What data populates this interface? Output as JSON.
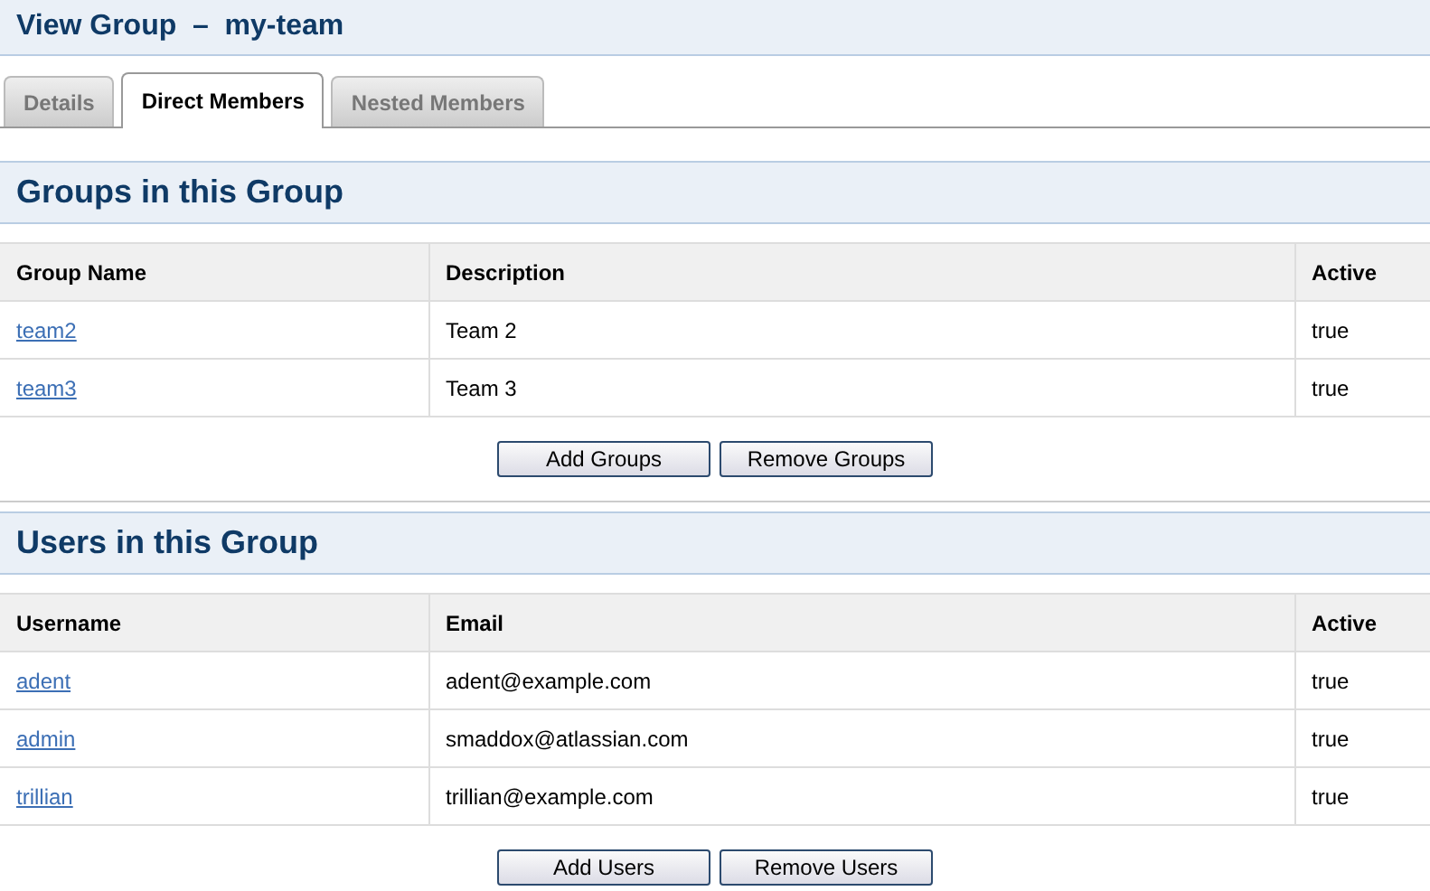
{
  "title": "View Group  –  my-team",
  "tabs": [
    {
      "label": "Details",
      "selected": false
    },
    {
      "label": "Direct Members",
      "selected": true
    },
    {
      "label": "Nested Members",
      "selected": false
    }
  ],
  "sections": [
    {
      "heading": "Groups in this Group",
      "columns": [
        "Group Name",
        "Description",
        "Active"
      ],
      "rows": [
        [
          "team2",
          "Team 2",
          "true"
        ],
        [
          "team3",
          "Team 3",
          "true"
        ]
      ],
      "buttons": [
        "Add Groups",
        "Remove Groups"
      ]
    },
    {
      "heading": "Users in this Group",
      "columns": [
        "Username",
        "Email",
        "Active"
      ],
      "rows": [
        [
          "adent",
          "adent@example.com",
          "true"
        ],
        [
          "admin",
          "smaddox@atlassian.com",
          "true"
        ],
        [
          "trillian",
          "trillian@example.com",
          "true"
        ]
      ],
      "buttons": [
        "Add Users",
        "Remove Users"
      ]
    }
  ]
}
